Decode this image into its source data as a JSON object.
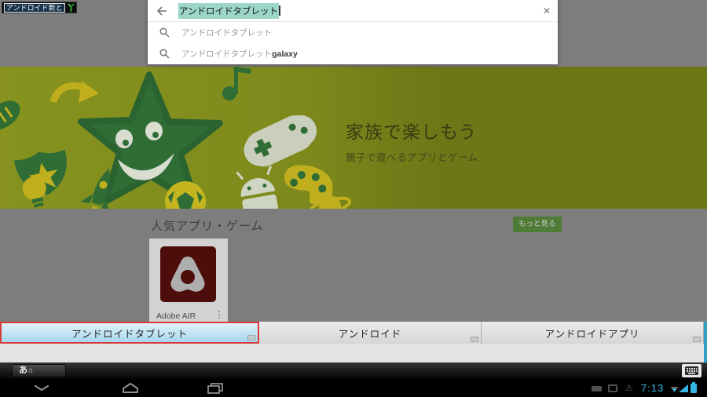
{
  "composition": {
    "text": "アンドロイド新と"
  },
  "search": {
    "query": "アンドロイドタブレット",
    "suggestions": [
      {
        "text": "アンドロイドタブレット",
        "suffix": ""
      },
      {
        "text": "アンドロイドタブレット",
        "suffix": "galaxy"
      }
    ]
  },
  "banner": {
    "title": "家族で楽しもう",
    "subtitle": "親子で遊べるアプリとゲーム"
  },
  "section": {
    "title": "人気アプリ・ゲーム",
    "more_label": "もっと見る"
  },
  "app_card": {
    "name": "Adobe AIR",
    "overflow_icon": "⋮"
  },
  "ime": {
    "candidates": [
      "アンドロイドタブレット",
      "アンドロイド",
      "アンドロイドアプリ"
    ],
    "mode_primary": "あ",
    "mode_secondary": "a"
  },
  "status": {
    "time": "7:13",
    "warning_icon": "⚠"
  },
  "icons": {
    "close": "✕"
  },
  "colors": {
    "holo_blue": "#33B5E5",
    "selection_teal": "#9BD6C9",
    "candidate_selected_border": "#D93B3B",
    "more_button_green": "#4E7B35",
    "banner_olive": "#6D7717",
    "app_icon_maroon": "#4C0D0B"
  }
}
